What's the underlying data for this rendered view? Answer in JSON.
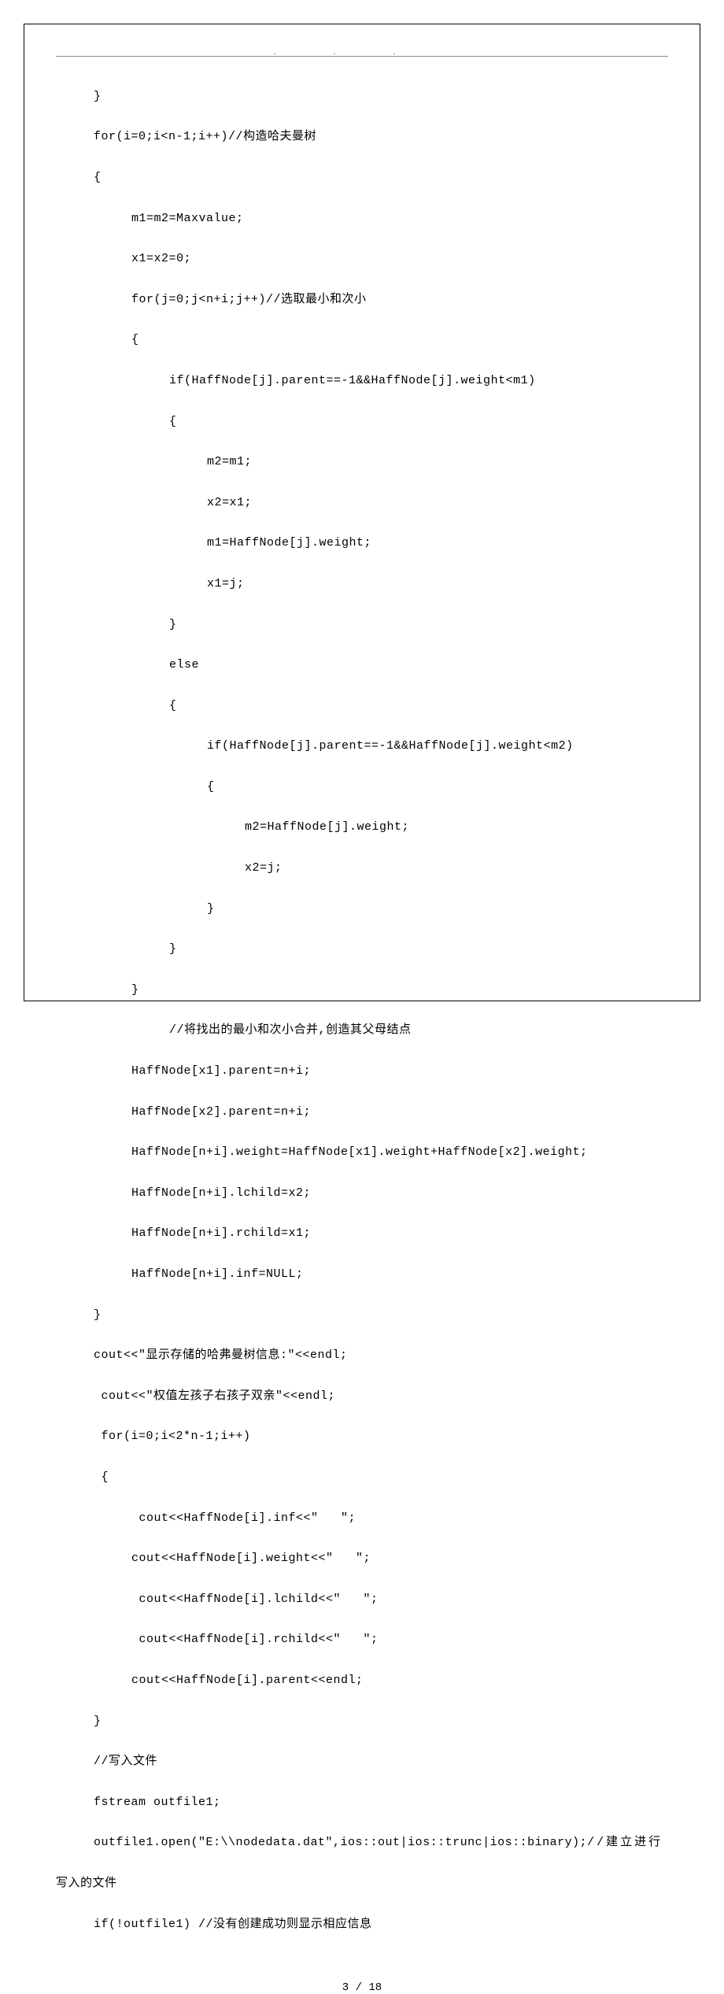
{
  "code": {
    "l1": "}",
    "l2": "for(i=0;i<n-1;i++)//构造哈夫曼树",
    "l3": "{",
    "l4": "m1=m2=Maxvalue;",
    "l5": "x1=x2=0;",
    "l6": "for(j=0;j<n+i;j++)//选取最小和次小",
    "l7": "{",
    "l8": "if(HaffNode[j].parent==-1&&HaffNode[j].weight<m1)",
    "l9": "{",
    "l10": "m2=m1;",
    "l11": "x2=x1;",
    "l12": "m1=HaffNode[j].weight;",
    "l13": "x1=j;",
    "l14": "}",
    "l15": "else",
    "l16": "{",
    "l17": "if(HaffNode[j].parent==-1&&HaffNode[j].weight<m2)",
    "l18": "{",
    "l19": "m2=HaffNode[j].weight;",
    "l20": "x2=j;",
    "l21": "}",
    "l22": "}",
    "l23": "}",
    "l24": "//将找出的最小和次小合并,创造其父母结点",
    "l25": "HaffNode[x1].parent=n+i;",
    "l26": "HaffNode[x2].parent=n+i;",
    "l27": "HaffNode[n+i].weight=HaffNode[x1].weight+HaffNode[x2].weight;",
    "l28": "HaffNode[n+i].lchild=x2;",
    "l29": "HaffNode[n+i].rchild=x1;",
    "l30": "HaffNode[n+i].inf=NULL;",
    "l31": "}",
    "l32": "cout<<\"显示存储的哈弗曼树信息:\"<<endl;",
    "l33": "cout<<\"权值左孩子右孩子双亲\"<<endl;",
    "l34": "for(i=0;i<2*n-1;i++)",
    "l35": "{",
    "l36": "cout<<HaffNode[i].inf<<\"   \";",
    "l37": "cout<<HaffNode[i].weight<<\"   \";",
    "l38": "cout<<HaffNode[i].lchild<<\"   \";",
    "l39": "cout<<HaffNode[i].rchild<<\"   \";",
    "l40": "cout<<HaffNode[i].parent<<endl;",
    "l41": "}",
    "l42": "//写入文件",
    "l43": "fstream outfile1;",
    "l44a": "outfile1.open(\"E:\\\\nodedata.dat\",ios::out|ios::trunc|ios::binary);",
    "l44b": "//建立进行",
    "l45": "写入的文件",
    "l46": "if(!outfile1) //没有创建成功则显示相应信息"
  },
  "footer": {
    "page": "3 / 18"
  }
}
